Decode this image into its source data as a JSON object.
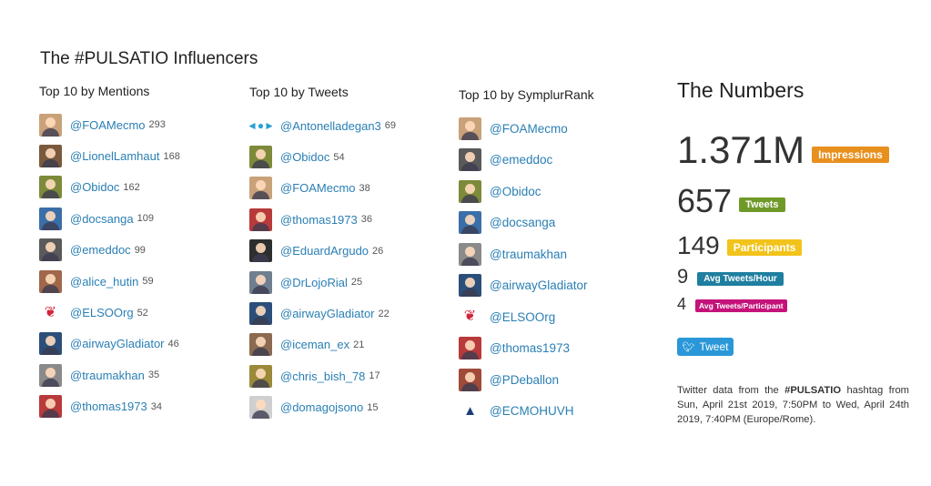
{
  "title": "The #PULSATIO Influencers",
  "mentions": {
    "heading": "Top 10 by Mentions",
    "rows": [
      {
        "handle": "@FOAMecmo",
        "count": "293",
        "color": "#c9a27a"
      },
      {
        "handle": "@LionelLamhaut",
        "count": "168",
        "color": "#7a5a3c"
      },
      {
        "handle": "@Obidoc",
        "count": "162",
        "color": "#7d8a3a"
      },
      {
        "handle": "@docsanga",
        "count": "109",
        "color": "#3a6fa8"
      },
      {
        "handle": "@emeddoc",
        "count": "99",
        "color": "#5a5a5a"
      },
      {
        "handle": "@alice_hutin",
        "count": "59",
        "color": "#a0674a"
      },
      {
        "handle": "@ELSOOrg",
        "count": "52",
        "color": "logo"
      },
      {
        "handle": "@airwayGladiator",
        "count": "46",
        "color": "#2b4f7a"
      },
      {
        "handle": "@traumakhan",
        "count": "35",
        "color": "#8a8a8a"
      },
      {
        "handle": "@thomas1973",
        "count": "34",
        "color": "#b83a3a"
      }
    ]
  },
  "tweets": {
    "heading": "Top 10 by Tweets",
    "rows": [
      {
        "handle": "@Antonelladegan3",
        "count": "69",
        "color": "candy"
      },
      {
        "handle": "@Obidoc",
        "count": "54",
        "color": "#7d8a3a"
      },
      {
        "handle": "@FOAMecmo",
        "count": "38",
        "color": "#c9a27a"
      },
      {
        "handle": "@thomas1973",
        "count": "36",
        "color": "#b83a3a"
      },
      {
        "handle": "@EduardArgudo",
        "count": "26",
        "color": "#2e2e2e"
      },
      {
        "handle": "@DrLojoRial",
        "count": "25",
        "color": "#6f7f90"
      },
      {
        "handle": "@airwayGladiator",
        "count": "22",
        "color": "#2b4f7a"
      },
      {
        "handle": "@iceman_ex",
        "count": "21",
        "color": "#8a6a50"
      },
      {
        "handle": "@chris_bish_78",
        "count": "17",
        "color": "#9a8a3a"
      },
      {
        "handle": "@domagojsono",
        "count": "15",
        "color": "#cfcfcf"
      }
    ]
  },
  "symplur": {
    "heading": "Top 10 by SymplurRank",
    "rows": [
      {
        "handle": "@FOAMecmo",
        "color": "#c9a27a"
      },
      {
        "handle": "@emeddoc",
        "color": "#5a5a5a"
      },
      {
        "handle": "@Obidoc",
        "color": "#7d8a3a"
      },
      {
        "handle": "@docsanga",
        "color": "#3a6fa8"
      },
      {
        "handle": "@traumakhan",
        "color": "#8a8a8a"
      },
      {
        "handle": "@airwayGladiator",
        "color": "#2b4f7a"
      },
      {
        "handle": "@ELSOOrg",
        "color": "logo"
      },
      {
        "handle": "@thomas1973",
        "color": "#b83a3a"
      },
      {
        "handle": "@PDeballon",
        "color": "#a04a3a"
      },
      {
        "handle": "@ECMOHUVH",
        "color": "ecmo"
      }
    ]
  },
  "numbers": {
    "heading": "The Numbers",
    "impressions": {
      "value": "1.371M",
      "label": "Impressions",
      "color": "#e8901e"
    },
    "tweets": {
      "value": "657",
      "label": "Tweets",
      "color": "#6f9a2a"
    },
    "participants": {
      "value": "149",
      "label": "Participants",
      "color": "#f2c31a"
    },
    "avg_hour": {
      "value": "9",
      "label": "Avg Tweets/Hour",
      "color": "#1f7fa0"
    },
    "avg_participant": {
      "value": "4",
      "label": "Avg Tweets/Participant",
      "color": "#c4127a"
    }
  },
  "tweet_button": {
    "label": "Tweet",
    "icon": "twitter-bird-icon"
  },
  "footer": {
    "pre": "Twitter data from the ",
    "hashtag": "#PULSATIO",
    "post": " hashtag from Sun, April 21st 2019, 7:50PM to Wed, April 24th 2019, 7:40PM (Europe/Rome)."
  }
}
